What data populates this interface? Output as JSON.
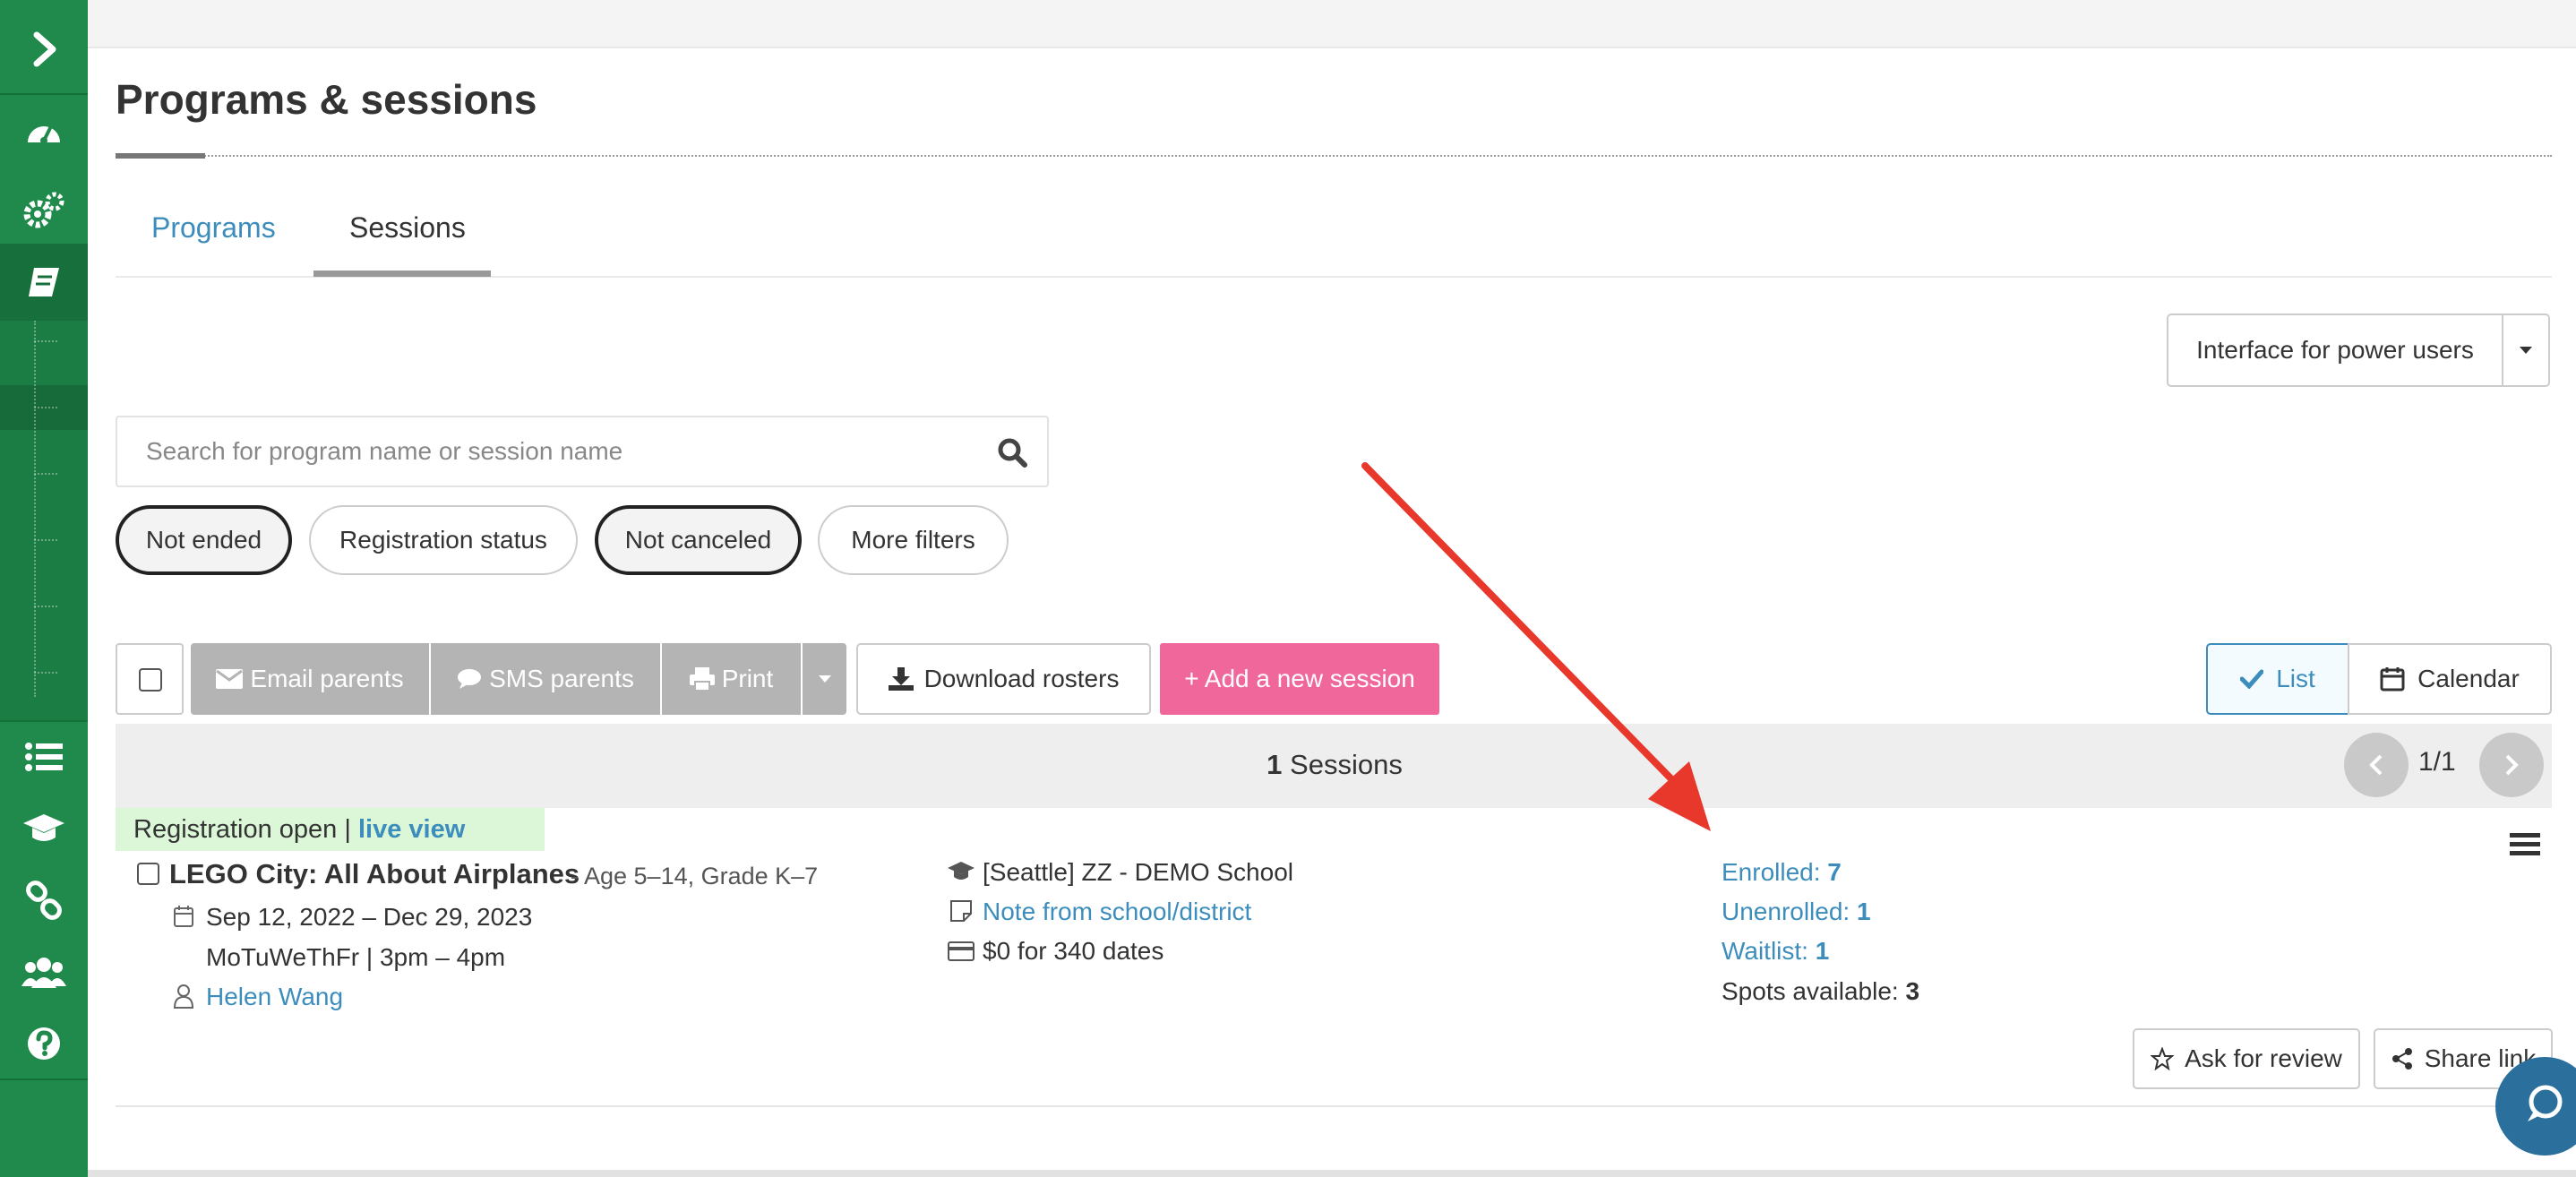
{
  "header": {
    "title": "Programs & sessions",
    "tabs": [
      {
        "label": "Programs",
        "active": false
      },
      {
        "label": "Sessions",
        "active": true
      }
    ]
  },
  "power_users": {
    "label": "Interface for power users"
  },
  "search": {
    "placeholder": "Search for program name or session name",
    "value": ""
  },
  "filters": [
    {
      "label": "Not ended",
      "active": true
    },
    {
      "label": "Registration status",
      "active": false
    },
    {
      "label": "Not canceled",
      "active": true
    },
    {
      "label": "More filters",
      "active": false
    }
  ],
  "toolbar": {
    "email_label": "Email parents",
    "sms_label": "SMS parents",
    "print_label": "Print",
    "download_label": "Download rosters",
    "add_label": "+ Add a new session"
  },
  "view_toggle": {
    "list_label": "List",
    "calendar_label": "Calendar",
    "selected": "List"
  },
  "results": {
    "count": "1",
    "count_suffix": "Sessions",
    "page": "1/1"
  },
  "session": {
    "status_text": "Registration open |",
    "status_link": "live view",
    "name": "LEGO City: All About Airplanes",
    "meta": "- Age 5–14, Grade K–7",
    "date_range": "Sep 12, 2022 – Dec 29, 2023",
    "schedule": "MoTuWeThFr | 3pm – 4pm",
    "instructor": "Helen Wang",
    "school": "[Seattle] ZZ - DEMO School",
    "note_link": "Note from school/district",
    "price": "$0 for 340 dates",
    "enrolled_label": "Enrolled:",
    "enrolled_value": "7",
    "unenrolled_label": "Unenrolled:",
    "unenrolled_value": "1",
    "waitlist_label": "Waitlist:",
    "waitlist_value": "1",
    "spots_label": "Spots available:",
    "spots_value": "3",
    "review_label": "Ask for review",
    "share_label": "Share link"
  },
  "colors": {
    "sidebar": "#1f8a4c",
    "link": "#3c8dbc",
    "primary_action": "#f0689b",
    "annotation_arrow": "#e8372b"
  }
}
